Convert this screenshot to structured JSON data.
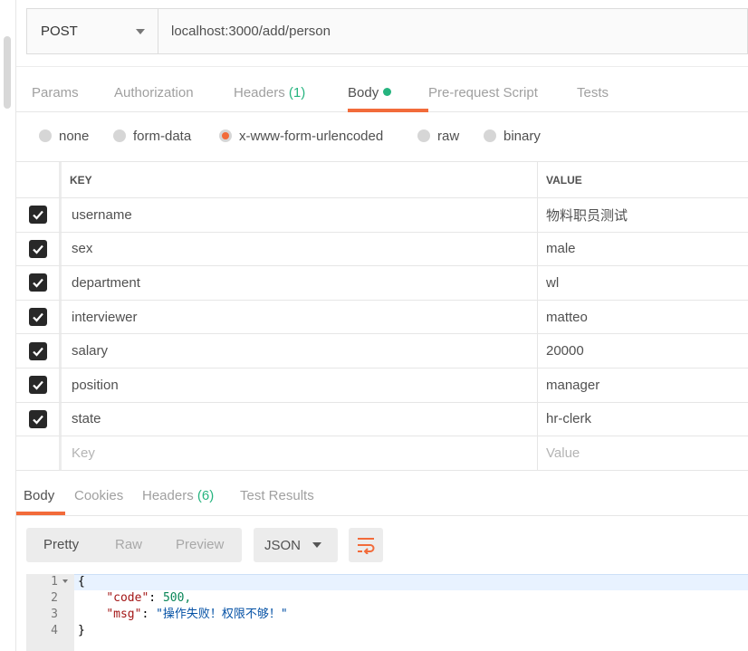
{
  "request": {
    "method": "POST",
    "url": "localhost:3000/add/person"
  },
  "request_tabs": [
    {
      "label": "Params"
    },
    {
      "label": "Authorization"
    },
    {
      "label": "Headers",
      "count": "(1)"
    },
    {
      "label": "Body"
    },
    {
      "label": "Pre-request Script"
    },
    {
      "label": "Tests"
    }
  ],
  "body_types": [
    {
      "label": "none"
    },
    {
      "label": "form-data"
    },
    {
      "label": "x-www-form-urlencoded",
      "selected": true
    },
    {
      "label": "raw"
    },
    {
      "label": "binary"
    }
  ],
  "params_table": {
    "headers": {
      "key": "KEY",
      "value": "VALUE"
    },
    "rows": [
      {
        "key": "username",
        "value": "物料职员测试",
        "checked": true
      },
      {
        "key": "sex",
        "value": "male",
        "checked": true
      },
      {
        "key": "department",
        "value": "wl",
        "checked": true
      },
      {
        "key": "interviewer",
        "value": "matteo",
        "checked": true
      },
      {
        "key": "salary",
        "value": "20000",
        "checked": true
      },
      {
        "key": "position",
        "value": "manager",
        "checked": true
      },
      {
        "key": "state",
        "value": "hr-clerk",
        "checked": true
      }
    ],
    "placeholder": {
      "key": "Key",
      "value": "Value"
    }
  },
  "response_tabs": [
    {
      "label": "Body"
    },
    {
      "label": "Cookies"
    },
    {
      "label": "Headers",
      "count": "(6)"
    },
    {
      "label": "Test Results"
    }
  ],
  "response_view": {
    "modes": [
      "Pretty",
      "Raw",
      "Preview"
    ],
    "format": "JSON"
  },
  "response_code": {
    "line_numbers": [
      "1",
      "2",
      "3",
      "4"
    ],
    "open_brace": "{",
    "close_brace": "}",
    "code_key": "\"code\"",
    "code_value": "500,",
    "msg_key": "\"msg\"",
    "msg_value": "\"操作失败！权限不够！\""
  },
  "colors": {
    "accent": "#f26b3a",
    "count_green": "#26b47f"
  }
}
